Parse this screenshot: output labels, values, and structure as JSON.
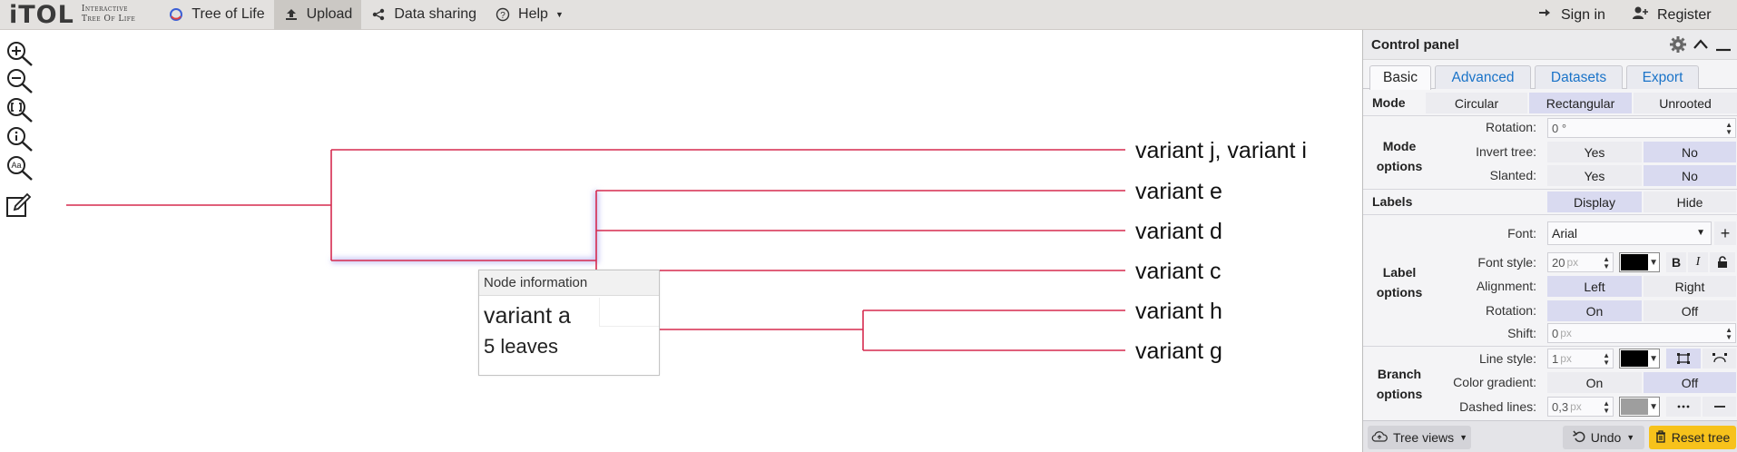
{
  "nav": {
    "logo_main": "iTOL",
    "logo_sub_1": "Interactive",
    "logo_sub_2": "Tree Of Life",
    "tree_of_life": "Tree of Life",
    "upload": "Upload",
    "data_sharing": "Data sharing",
    "help": "Help",
    "sign_in": "Sign in",
    "register": "Register"
  },
  "tools": [
    "zoom-in-icon",
    "zoom-out-icon",
    "zoom-fit-icon",
    "info-icon",
    "font-size-icon",
    "edit-icon"
  ],
  "tree": {
    "leaves": [
      "variant j, variant i",
      "variant e",
      "variant d",
      "variant c",
      "variant h",
      "variant g"
    ],
    "branch_color": "#d62a4f"
  },
  "node_info": {
    "header": "Node information",
    "name": "variant a",
    "leaves": "5 leaves"
  },
  "control_panel": {
    "title": "Control panel",
    "tabs": [
      "Basic",
      "Advanced",
      "Datasets",
      "Export"
    ],
    "active_tab": "Basic",
    "mode": {
      "label": "Mode",
      "options": [
        "Circular",
        "Rectangular",
        "Unrooted"
      ],
      "selected": "Rectangular"
    },
    "mode_options": {
      "section": "Mode options",
      "rotation_label": "Rotation:",
      "rotation_value": "0 °",
      "invert_label": "Invert tree:",
      "slanted_label": "Slanted:",
      "yes": "Yes",
      "no": "No"
    },
    "labels": {
      "section": "Labels",
      "display": "Display",
      "hide": "Hide"
    },
    "label_options": {
      "section": "Label options",
      "font_label": "Font:",
      "font_value": "Arial",
      "font_style_label": "Font style:",
      "font_size": "20",
      "unit_px": "px",
      "bold": "B",
      "italic": "I",
      "alignment_label": "Alignment:",
      "left": "Left",
      "right": "Right",
      "rotation_label": "Rotation:",
      "on": "On",
      "off": "Off",
      "shift_label": "Shift:",
      "shift_value": "0",
      "label_color": "#000000"
    },
    "branch_options": {
      "section": "Branch options",
      "line_style_label": "Line style:",
      "line_width": "1",
      "line_color": "#000000",
      "color_gradient_label": "Color gradient:",
      "on": "On",
      "off": "Off",
      "dashed_label": "Dashed lines:",
      "dashed_value": "0,3",
      "dashed_color": "#9e9e9e"
    },
    "footer": {
      "tree_views": "Tree views",
      "undo": "Undo",
      "reset_tree": "Reset tree",
      "reset_color": "#f7c21b"
    }
  }
}
